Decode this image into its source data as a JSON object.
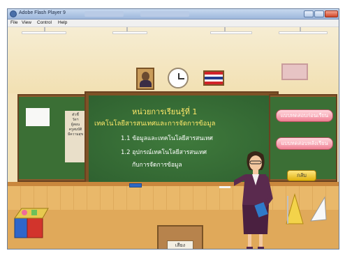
{
  "window": {
    "title": "Adobe Flash Player 9"
  },
  "menu": {
    "items": [
      "File",
      "View",
      "Control",
      "Help"
    ]
  },
  "board": {
    "title": "หน่วยการเรียนรู้ที่ 1",
    "subtitle": "เทคโนโลยีสารสนเทศและการจัดการข้อมูล",
    "item1": "1.1  ข้อมูลและเทคโนโลยีสารสนเทศ",
    "item2": "1.2  อุปกรณ์เทคโนโลยีสารสนเทศ",
    "item2b": "กับการจัดการข้อมูล"
  },
  "side_note": {
    "lines": [
      "ตัวชี้",
      "วัดฯ",
      "ผู้สอน",
      "ครูสมบัติ",
      "มีความสุข"
    ]
  },
  "buttons": {
    "pretest": "แบบทดสอบก่อนเรียน",
    "posttest": "แบบทดสอบหลังเรียน",
    "back": "กลับ",
    "sound": "เสียง"
  },
  "colors": {
    "board_green": "#3b6f35",
    "pill_pink": "#f07f93",
    "back_yellow": "#e0b20e",
    "title_yellow": "#ffe96a"
  },
  "icons": {
    "window": "flash-player-icon",
    "clock": "clock-icon",
    "flag": "thai-flag-icon"
  }
}
